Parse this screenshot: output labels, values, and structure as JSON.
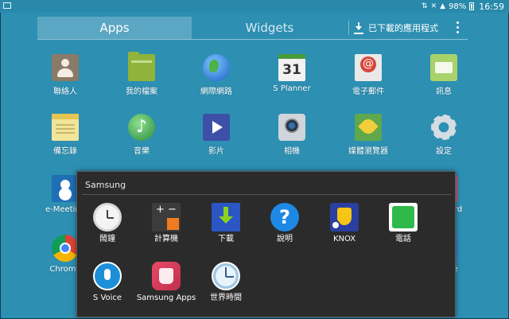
{
  "status_bar": {
    "battery_percent": "98%",
    "time": "16:59"
  },
  "tabs": {
    "apps": "Apps",
    "widgets": "Widgets",
    "downloaded": "已下載的應用程式"
  },
  "grid": {
    "row1": [
      "聯絡人",
      "我的檔案",
      "網際網路",
      "S Planner",
      "電子郵件",
      "訊息"
    ],
    "row2": [
      "備忘錄",
      "音樂",
      "影片",
      "相機",
      "媒體瀏覽器",
      "設定"
    ],
    "row3_left": "e-Meeting",
    "row3_right": "Flipboard",
    "row4_left": "Chrome",
    "row4_right": "Google",
    "calendar_day": "31"
  },
  "folder": {
    "title": "Samsung",
    "row1": [
      "鬧鐘",
      "計算機",
      "下載",
      "說明",
      "KNOX",
      "電話"
    ],
    "row2": [
      "S Voice",
      "Samsung Apps",
      "世界時間"
    ],
    "help_glyph": "?"
  }
}
